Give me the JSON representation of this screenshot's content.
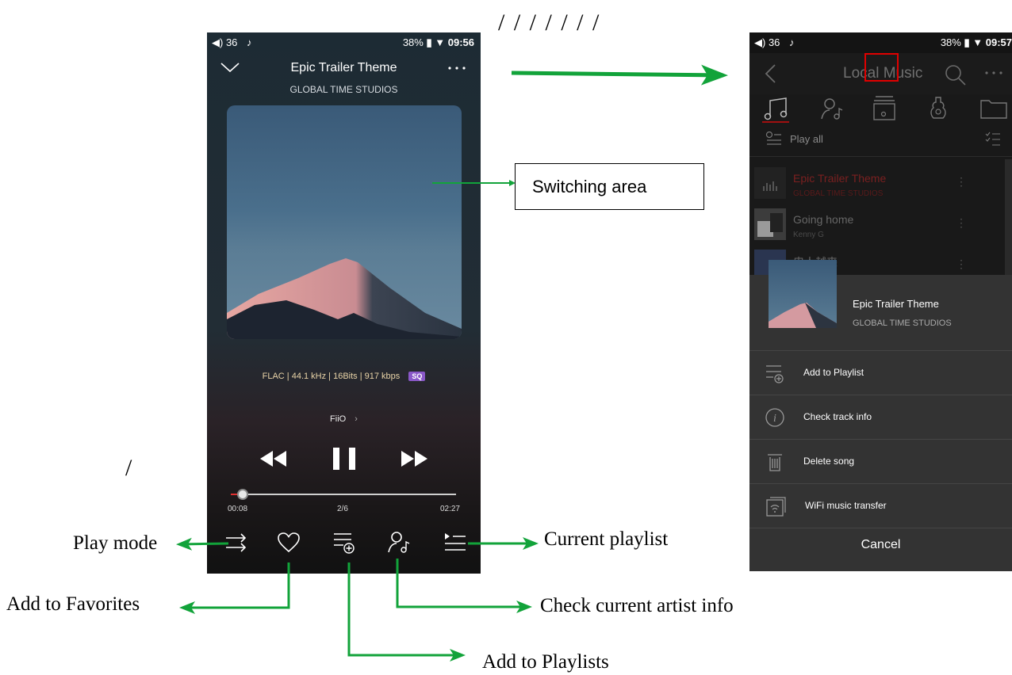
{
  "phone1": {
    "status": {
      "volume": "36",
      "battery": "38%",
      "time": "09:56"
    },
    "song_title": "Epic Trailer Theme",
    "song_artist": "GLOBAL TIME STUDIOS",
    "format_info": "FLAC | 44.1 kHz | 16Bits | 917 kbps",
    "quality_badge": "SQ",
    "output_device": "FiiO",
    "progress": {
      "elapsed": "00:08",
      "total": "02:27",
      "track_index": "2/6",
      "fraction": 0.054
    }
  },
  "phone2": {
    "status": {
      "volume": "36",
      "battery": "38%",
      "time": "09:57"
    },
    "title": "Local Music",
    "play_all": "Play all",
    "tracks": [
      {
        "title": "Epic Trailer Theme",
        "artist": "GLOBAL TIME STUDIOS"
      },
      {
        "title": "Going home",
        "artist": "Kenny G"
      },
      {
        "title": "忠人越来",
        "artist": ""
      }
    ],
    "sheet": {
      "title": "Epic Trailer Theme",
      "artist": "GLOBAL TIME STUDIOS",
      "items": [
        "Add to Playlist",
        "Check track info",
        "Delete song",
        "WiFi music transfer"
      ],
      "cancel": "Cancel"
    }
  },
  "annotations": {
    "switching_area": "Switching area",
    "play_mode": "Play mode",
    "current_playlist": "Current playlist",
    "add_to_favorites": "Add to Favorites",
    "check_artist": "Check current artist info",
    "add_to_playlists": "Add to Playlists",
    "slashes_top": "/ / / / / / /",
    "slash_left": "/"
  },
  "colors": {
    "accent_red": "#e03030",
    "annotation_green": "#12a33a",
    "sq_purple": "#8a58c8"
  }
}
